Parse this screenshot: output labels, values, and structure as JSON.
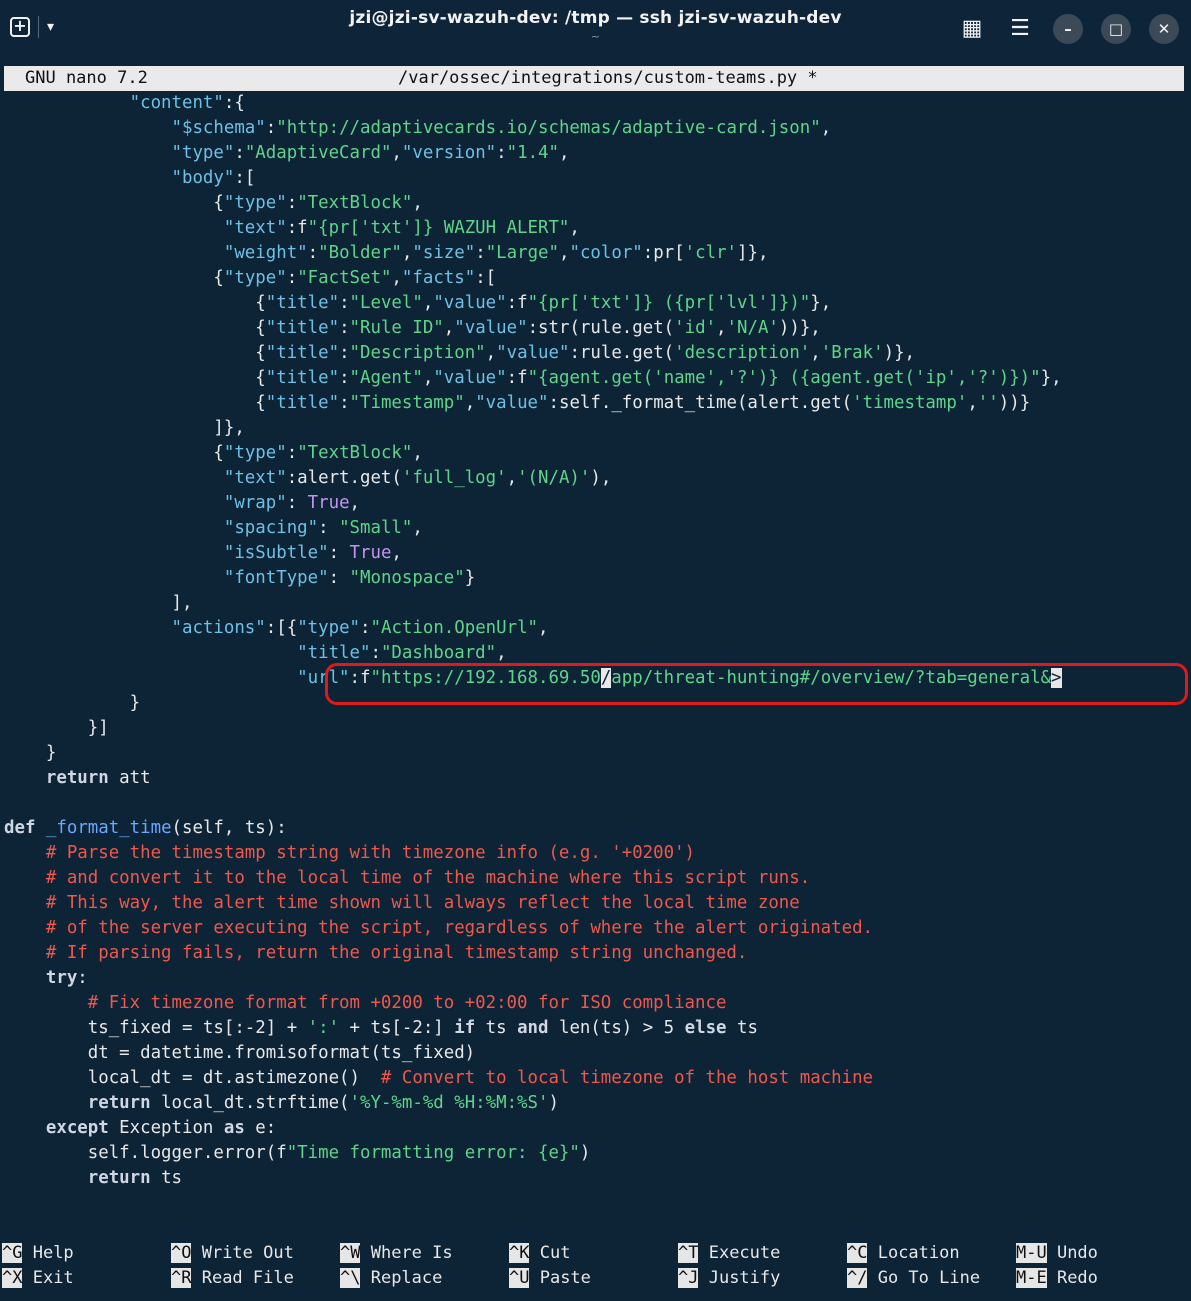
{
  "window": {
    "title": "jzi@jzi-sv-wazuh-dev: /tmp — ssh jzi-sv-wazuh-dev",
    "subtitle": "~",
    "icons": [
      "new-tab-icon",
      "chevron-down-icon",
      "grid-icon",
      "menu-icon",
      "minimize-icon",
      "maximize-icon",
      "close-icon"
    ]
  },
  "nano": {
    "version": "GNU nano 7.2",
    "filename": "/var/ossec/integrations/custom-teams.py *"
  },
  "editor": {
    "lines": [
      [
        [
          "k",
          "            \"content\""
        ],
        [
          "p",
          ":{"
        ]
      ],
      [
        [
          "k",
          "                \"$schema\""
        ],
        [
          "p",
          ":"
        ],
        [
          "s",
          "\"http://adaptivecards.io/schemas/adaptive-card.json\""
        ],
        [
          "p",
          ","
        ]
      ],
      [
        [
          "k",
          "                \"type\""
        ],
        [
          "p",
          ":"
        ],
        [
          "s",
          "\"AdaptiveCard\""
        ],
        [
          "p",
          ","
        ],
        [
          "k",
          "\"version\""
        ],
        [
          "p",
          ":"
        ],
        [
          "s",
          "\"1.4\""
        ],
        [
          "p",
          ","
        ]
      ],
      [
        [
          "k",
          "                \"body\""
        ],
        [
          "p",
          ":["
        ]
      ],
      [
        [
          "p",
          "                    {"
        ],
        [
          "k",
          "\"type\""
        ],
        [
          "p",
          ":"
        ],
        [
          "s",
          "\"TextBlock\""
        ],
        [
          "p",
          ","
        ]
      ],
      [
        [
          "k",
          "                     \"text\""
        ],
        [
          "p",
          ":f"
        ],
        [
          "s",
          "\"{pr['txt']} WAZUH ALERT\""
        ],
        [
          "p",
          ","
        ]
      ],
      [
        [
          "k",
          "                     \"weight\""
        ],
        [
          "p",
          ":"
        ],
        [
          "s",
          "\"Bolder\""
        ],
        [
          "p",
          ","
        ],
        [
          "k",
          "\"size\""
        ],
        [
          "p",
          ":"
        ],
        [
          "s",
          "\"Large\""
        ],
        [
          "p",
          ","
        ],
        [
          "k",
          "\"color\""
        ],
        [
          "p",
          ":pr["
        ],
        [
          "s",
          "'clr'"
        ],
        [
          "p",
          "]},"
        ]
      ],
      [
        [
          "p",
          "                    {"
        ],
        [
          "k",
          "\"type\""
        ],
        [
          "p",
          ":"
        ],
        [
          "s",
          "\"FactSet\""
        ],
        [
          "p",
          ","
        ],
        [
          "k",
          "\"facts\""
        ],
        [
          "p",
          ":["
        ]
      ],
      [
        [
          "p",
          "                        {"
        ],
        [
          "k",
          "\"title\""
        ],
        [
          "p",
          ":"
        ],
        [
          "s",
          "\"Level\""
        ],
        [
          "p",
          ","
        ],
        [
          "k",
          "\"value\""
        ],
        [
          "p",
          ":f"
        ],
        [
          "s",
          "\"{pr['txt']} ({pr['lvl']})\""
        ],
        [
          "p",
          "},"
        ]
      ],
      [
        [
          "p",
          "                        {"
        ],
        [
          "k",
          "\"title\""
        ],
        [
          "p",
          ":"
        ],
        [
          "s",
          "\"Rule ID\""
        ],
        [
          "p",
          ","
        ],
        [
          "k",
          "\"value\""
        ],
        [
          "p",
          ":str(rule.get("
        ],
        [
          "s",
          "'id'"
        ],
        [
          "p",
          ","
        ],
        [
          "s",
          "'N/A'"
        ],
        [
          "p",
          "))},"
        ]
      ],
      [
        [
          "p",
          "                        {"
        ],
        [
          "k",
          "\"title\""
        ],
        [
          "p",
          ":"
        ],
        [
          "s",
          "\"Description\""
        ],
        [
          "p",
          ","
        ],
        [
          "k",
          "\"value\""
        ],
        [
          "p",
          ":rule.get("
        ],
        [
          "s",
          "'description'"
        ],
        [
          "p",
          ","
        ],
        [
          "s",
          "'Brak'"
        ],
        [
          "p",
          ")},"
        ]
      ],
      [
        [
          "p",
          "                        {"
        ],
        [
          "k",
          "\"title\""
        ],
        [
          "p",
          ":"
        ],
        [
          "s",
          "\"Agent\""
        ],
        [
          "p",
          ","
        ],
        [
          "k",
          "\"value\""
        ],
        [
          "p",
          ":f"
        ],
        [
          "s",
          "\"{agent.get('name','?')} ({agent.get('ip','?')})\""
        ],
        [
          "p",
          "},"
        ]
      ],
      [
        [
          "p",
          "                        {"
        ],
        [
          "k",
          "\"title\""
        ],
        [
          "p",
          ":"
        ],
        [
          "s",
          "\"Timestamp\""
        ],
        [
          "p",
          ","
        ],
        [
          "k",
          "\"value\""
        ],
        [
          "p",
          ":self._format_time(alert.get("
        ],
        [
          "s",
          "'timestamp'"
        ],
        [
          "p",
          ","
        ],
        [
          "s",
          "''"
        ],
        [
          "p",
          "))}"
        ]
      ],
      [
        [
          "p",
          "                    ]},"
        ]
      ],
      [
        [
          "p",
          "                    {"
        ],
        [
          "k",
          "\"type\""
        ],
        [
          "p",
          ":"
        ],
        [
          "s",
          "\"TextBlock\""
        ],
        [
          "p",
          ","
        ]
      ],
      [
        [
          "k",
          "                     \"text\""
        ],
        [
          "p",
          ":alert.get("
        ],
        [
          "s",
          "'full_log'"
        ],
        [
          "p",
          ","
        ],
        [
          "s",
          "'(N/A)'"
        ],
        [
          "p",
          "),"
        ]
      ],
      [
        [
          "k",
          "                     \"wrap\""
        ],
        [
          "p",
          ": "
        ],
        [
          "kc",
          "True"
        ],
        [
          "p",
          ","
        ]
      ],
      [
        [
          "k",
          "                     \"spacing\""
        ],
        [
          "p",
          ": "
        ],
        [
          "s",
          "\"Small\""
        ],
        [
          "p",
          ","
        ]
      ],
      [
        [
          "k",
          "                     \"isSubtle\""
        ],
        [
          "p",
          ": "
        ],
        [
          "kc",
          "True"
        ],
        [
          "p",
          ","
        ]
      ],
      [
        [
          "k",
          "                     \"fontType\""
        ],
        [
          "p",
          ": "
        ],
        [
          "s",
          "\"Monospace\""
        ],
        [
          "p",
          "}"
        ]
      ],
      [
        [
          "p",
          "                ],"
        ]
      ],
      [
        [
          "k",
          "                \"actions\""
        ],
        [
          "p",
          ":[{"
        ],
        [
          "k",
          "\"type\""
        ],
        [
          "p",
          ":"
        ],
        [
          "s",
          "\"Action.OpenUrl\""
        ],
        [
          "p",
          ","
        ]
      ],
      [
        [
          "k",
          "                            \"title\""
        ],
        [
          "p",
          ":"
        ],
        [
          "s",
          "\"Dashboard\""
        ],
        [
          "p",
          ","
        ]
      ],
      [
        [
          "k",
          "                            \"url\""
        ],
        [
          "p",
          ":f"
        ],
        [
          "s",
          "\"https://192.168.69.50"
        ],
        [
          "cur",
          "/"
        ],
        [
          "s",
          "app/threat-hunting#/overview/?tab=general&"
        ],
        [
          "cur",
          ">"
        ]
      ],
      [
        [
          "p",
          "            }"
        ]
      ],
      [
        [
          "p",
          "        }]"
        ]
      ],
      [
        [
          "p",
          "    }"
        ]
      ],
      [
        [
          "kw",
          "    return"
        ],
        [
          "p",
          " att"
        ]
      ],
      [
        [
          "p",
          ""
        ]
      ],
      [
        [
          "kw",
          "def"
        ],
        [
          "p",
          " "
        ],
        [
          "fn",
          "_format_time"
        ],
        [
          "p",
          "(self, ts):"
        ]
      ],
      [
        [
          "c",
          "    # Parse the timestamp string with timezone info (e.g. '+0200')"
        ]
      ],
      [
        [
          "c",
          "    # and convert it to the local time of the machine where this script runs."
        ]
      ],
      [
        [
          "c",
          "    # This way, the alert time shown will always reflect the local time zone"
        ]
      ],
      [
        [
          "c",
          "    # of the server executing the script, regardless of where the alert originated."
        ]
      ],
      [
        [
          "c",
          "    # If parsing fails, return the original timestamp string unchanged."
        ]
      ],
      [
        [
          "kw",
          "    try"
        ],
        [
          "p",
          ":"
        ]
      ],
      [
        [
          "c",
          "        # Fix timezone format from +0200 to +02:00 for ISO compliance"
        ]
      ],
      [
        [
          "p",
          "        ts_fixed = ts[:-2] + "
        ],
        [
          "s",
          "':'"
        ],
        [
          "p",
          " + ts[-2:] "
        ],
        [
          "kw",
          "if"
        ],
        [
          "p",
          " ts "
        ],
        [
          "kw",
          "and"
        ],
        [
          "p",
          " len(ts) > 5 "
        ],
        [
          "kw",
          "else"
        ],
        [
          "p",
          " ts"
        ]
      ],
      [
        [
          "p",
          "        dt = datetime.fromisoformat(ts_fixed)"
        ]
      ],
      [
        [
          "p",
          "        local_dt = dt.astimezone()  "
        ],
        [
          "c",
          "# Convert to local timezone of the host machine"
        ]
      ],
      [
        [
          "kw",
          "        return"
        ],
        [
          "p",
          " local_dt.strftime("
        ],
        [
          "s",
          "'%Y-%m-%d %H:%M:%S'"
        ],
        [
          "p",
          ")"
        ]
      ],
      [
        [
          "kw",
          "    except"
        ],
        [
          "p",
          " Exception "
        ],
        [
          "kw",
          "as"
        ],
        [
          "p",
          " e:"
        ]
      ],
      [
        [
          "p",
          "        self.logger.error(f"
        ],
        [
          "s",
          "\"Time formatting error: {e}\""
        ],
        [
          "p",
          ")"
        ]
      ],
      [
        [
          "kw",
          "        return"
        ],
        [
          "p",
          " ts"
        ]
      ]
    ]
  },
  "shortcuts": [
    {
      "key": "^G",
      "label": "Help"
    },
    {
      "key": "^X",
      "label": "Exit"
    },
    {
      "key": "^O",
      "label": "Write Out"
    },
    {
      "key": "^R",
      "label": "Read File"
    },
    {
      "key": "^W",
      "label": "Where Is"
    },
    {
      "key": "^\\",
      "label": "Replace"
    },
    {
      "key": "^K",
      "label": "Cut"
    },
    {
      "key": "^U",
      "label": "Paste"
    },
    {
      "key": "^T",
      "label": "Execute"
    },
    {
      "key": "^J",
      "label": "Justify"
    },
    {
      "key": "^C",
      "label": "Location"
    },
    {
      "key": "^/",
      "label": "Go To Line"
    },
    {
      "key": "M-U",
      "label": "Undo"
    },
    {
      "key": "M-E",
      "label": "Redo"
    }
  ],
  "colors": {
    "background": "#0d2336",
    "key": "#6ec0e6",
    "string": "#5fd58a",
    "comment": "#f0584c",
    "constant": "#c594f2",
    "function": "#6aa7ff",
    "highlight_box": "#e01a1a"
  }
}
